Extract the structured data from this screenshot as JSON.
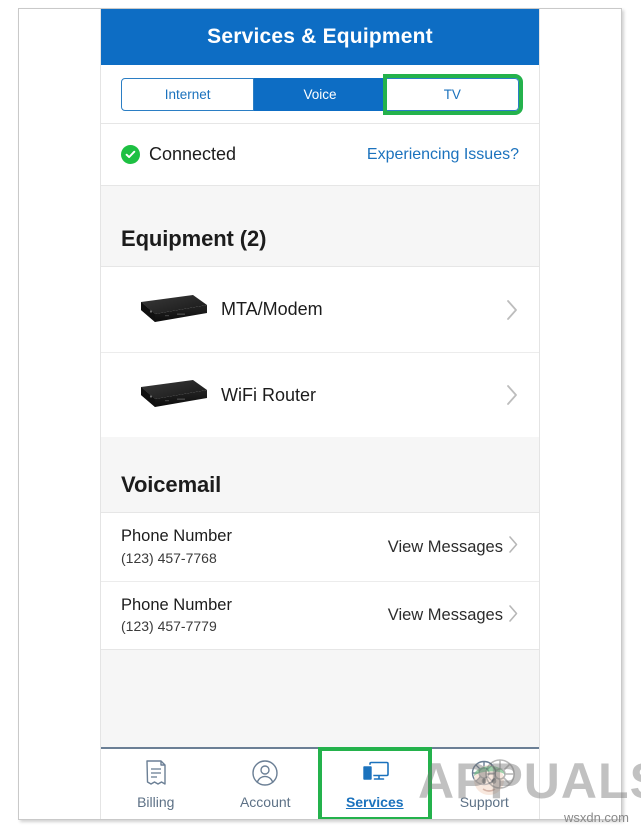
{
  "header": {
    "title": "Services & Equipment",
    "background_color": "#0d6dc4"
  },
  "tabs": [
    {
      "label": "Internet",
      "state": "inactive"
    },
    {
      "label": "Voice",
      "state": "selected"
    },
    {
      "label": "TV",
      "state": "highlighted"
    }
  ],
  "status": {
    "icon": "check-circle-icon",
    "label": "Connected",
    "link_label": "Experiencing Issues?",
    "ok_color": "#1dc042",
    "link_color": "#1b72bd"
  },
  "equipment": {
    "section_title": "Equipment (2)",
    "items": [
      {
        "label": "MTA/Modem",
        "icon": "modem-device-icon",
        "chevron": "chevron-right-icon"
      },
      {
        "label": "WiFi Router",
        "icon": "router-device-icon",
        "chevron": "chevron-right-icon"
      }
    ]
  },
  "voicemail": {
    "section_title": "Voicemail",
    "items": [
      {
        "title": "Phone Number",
        "number": "(123) 457-7768",
        "action": "View Messages",
        "chevron": "chevron-right-icon"
      },
      {
        "title": "Phone Number",
        "number": "(123) 457-7779",
        "action": "View Messages",
        "chevron": "chevron-right-icon"
      }
    ]
  },
  "bottom_nav": {
    "items": [
      {
        "label": "Billing",
        "icon": "invoice-icon",
        "active": false
      },
      {
        "label": "Account",
        "icon": "person-circle-icon",
        "active": false
      },
      {
        "label": "Services",
        "icon": "devices-icon",
        "active": true
      },
      {
        "label": "Support",
        "icon": "lifebuoy-icon",
        "active": false
      }
    ],
    "active_color": "#1b72bd",
    "inactive_color": "#5d7186"
  },
  "annotations": {
    "highlight_color": "#24b24c",
    "highlighted_elements": [
      "TV tab",
      "Services nav item"
    ]
  },
  "watermark": {
    "brand": "APPUALS",
    "site": "wsxdn.com"
  }
}
